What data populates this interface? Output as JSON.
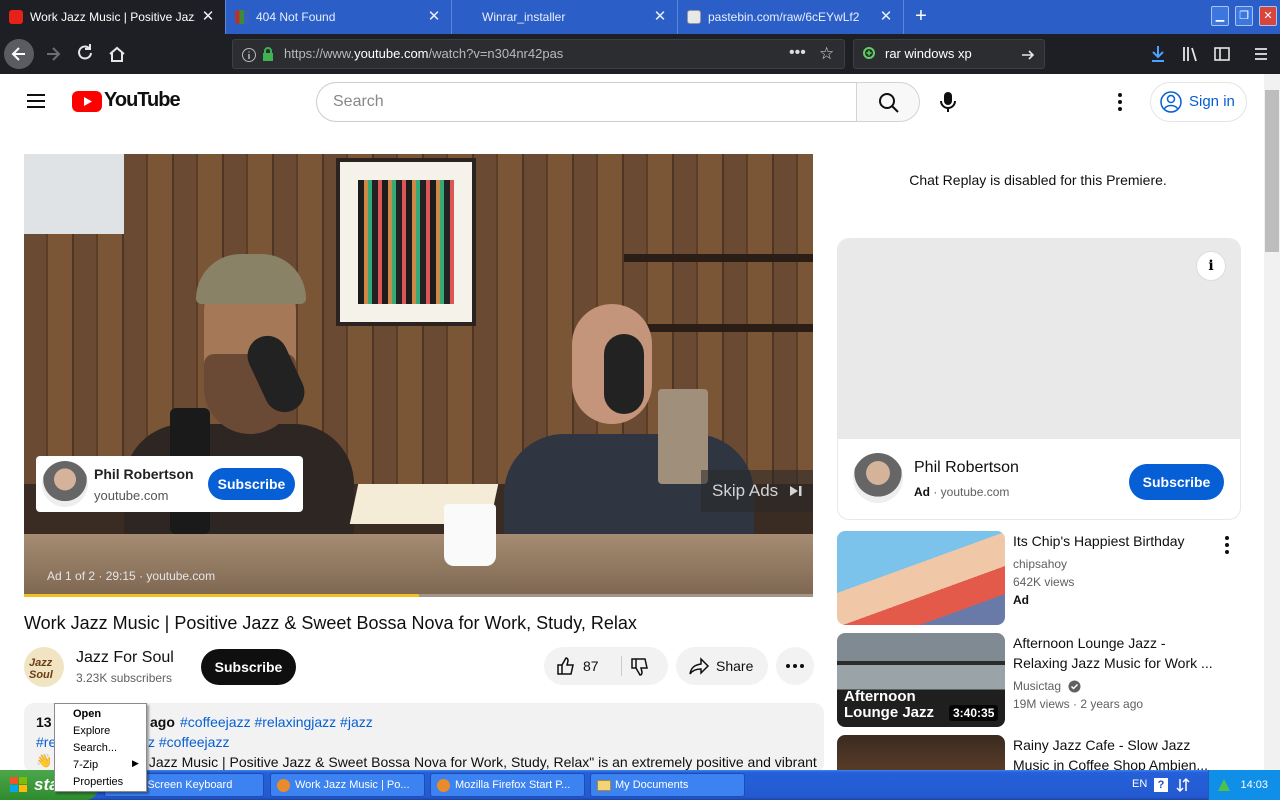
{
  "browser": {
    "tabs": [
      {
        "title": "Work Jazz Music | Positive Jazz &",
        "active": true,
        "icon": "youtube-icon"
      },
      {
        "title": "404 Not Found",
        "active": false,
        "icon": "winrar-icon"
      },
      {
        "title": "Winrar_installer",
        "active": false,
        "icon": "none"
      },
      {
        "title": "pastebin.com/raw/6cEYwLf2",
        "active": false,
        "icon": "page-icon"
      }
    ],
    "url_plain_prefix": "https://www.",
    "url_domain": "youtube.com",
    "url_path": "/watch?v=n304nr42pas",
    "search_value": "rar windows xp"
  },
  "youtube": {
    "logo_text": "YouTube",
    "search_placeholder": "Search",
    "signin_label": "Sign in",
    "player": {
      "ad_channel": "Phil Robertson",
      "ad_url": "youtube.com",
      "ad_subscribe": "Subscribe",
      "skip_label": "Skip Ads",
      "ad_info": "Ad 1 of 2 · 29:15 · youtube.com",
      "progress_fraction": 0.5
    },
    "video_title": "Work Jazz Music | Positive Jazz & Sweet Bossa Nova for Work, Study, Relax",
    "channel": {
      "avatar_text": "Jazz Soul",
      "name": "Jazz For Soul",
      "subscribers": "3.23K subscribers",
      "subscribe_label": "Subscribe"
    },
    "actions": {
      "likes": "87",
      "share_label": "Share"
    },
    "description": {
      "line1_prefix": "13",
      "line1_ago": "ago",
      "line1_tags": "#coffeejazz #relaxingjazz #jazz",
      "line2_a": "#re",
      "line2_b": "z #coffeejazz",
      "line3": "k Jazz Music | Positive Jazz & Sweet Bossa Nova for Work, Study, Relax\" is an extremely positive and vibrant"
    },
    "chat_disabled": "Chat Replay is disabled for this Premiere.",
    "side_ad": {
      "channel": "Phil Robertson",
      "ad_badge": "Ad",
      "url": "youtube.com",
      "subscribe": "Subscribe"
    },
    "recommendations": [
      {
        "title": "Its Chip's Happiest Birthday",
        "channel": "chipsahoy",
        "meta": "642K views",
        "badge": "Ad",
        "duration": ""
      },
      {
        "title": "Afternoon Lounge Jazz - Relaxing Jazz Music for Work ...",
        "channel": "Musictag",
        "meta": "19M views · 2 years ago",
        "badge": "",
        "duration": "3:40:35",
        "thumb_text": "Afternoon Lounge Jazz"
      },
      {
        "title": "Rainy Jazz Cafe - Slow Jazz Music in Coffee Shop Ambien...",
        "channel": "",
        "meta": "",
        "badge": "",
        "duration": ""
      }
    ]
  },
  "context_menu": {
    "items": [
      "Open",
      "Explore",
      "Search...",
      "7-Zip",
      "Properties"
    ]
  },
  "taskbar": {
    "start_label": "start",
    "tasks": [
      "On-Screen Keyboard",
      "Work Jazz Music | Po...",
      "Mozilla Firefox Start P...",
      "My Documents"
    ],
    "lang": "EN",
    "clock": "14:03"
  }
}
